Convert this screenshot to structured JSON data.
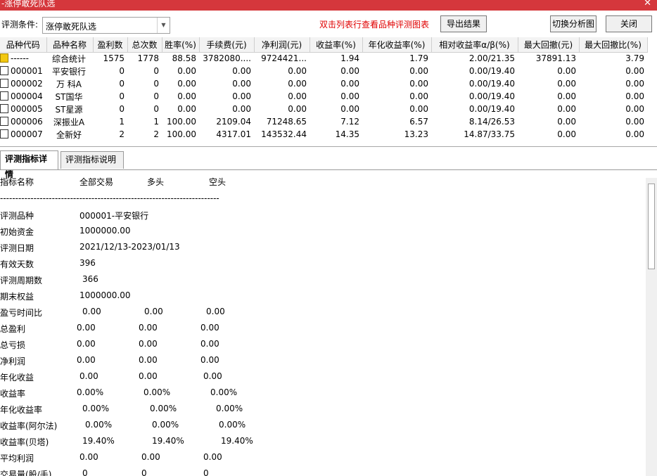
{
  "window": {
    "title": "-涨停敢死队选"
  },
  "toolbar": {
    "condition_label": "评测条件:",
    "condition_value": "涨停敢死队选",
    "hint": "双击列表行查看品种评测图表",
    "export_label": "导出结果",
    "switch_label": "切换分析图",
    "close_label": "关闭"
  },
  "grid": {
    "columns": [
      "品种代码",
      "品种名称",
      "盈利数",
      "总次数",
      "胜率(%)",
      "手续费(元)",
      "净利润(元)",
      "收益率(%)",
      "年化收益率(%)",
      "相对收益率α/β(%)",
      "最大回撤(元)",
      "最大回撤比(%)"
    ],
    "rows": [
      {
        "code": "------",
        "name": "综合统计",
        "win": "1575",
        "total": "1778",
        "rate": "88.58",
        "fee": "3782080....",
        "profit": "9724421...",
        "ret": "1.94",
        "annual": "1.79",
        "rel": "2.00/21.35",
        "dd": "37891.13",
        "ddr": "3.79",
        "summary": true
      },
      {
        "code": "000001",
        "name": "平安银行",
        "win": "0",
        "total": "0",
        "rate": "0.00",
        "fee": "0.00",
        "profit": "0.00",
        "ret": "0.00",
        "annual": "0.00",
        "rel": "0.00/19.40",
        "dd": "0.00",
        "ddr": "0.00"
      },
      {
        "code": "000002",
        "name": "万 科A",
        "win": "0",
        "total": "0",
        "rate": "0.00",
        "fee": "0.00",
        "profit": "0.00",
        "ret": "0.00",
        "annual": "0.00",
        "rel": "0.00/19.40",
        "dd": "0.00",
        "ddr": "0.00"
      },
      {
        "code": "000004",
        "name": "ST国华",
        "win": "0",
        "total": "0",
        "rate": "0.00",
        "fee": "0.00",
        "profit": "0.00",
        "ret": "0.00",
        "annual": "0.00",
        "rel": "0.00/19.40",
        "dd": "0.00",
        "ddr": "0.00"
      },
      {
        "code": "000005",
        "name": "ST星源",
        "win": "0",
        "total": "0",
        "rate": "0.00",
        "fee": "0.00",
        "profit": "0.00",
        "ret": "0.00",
        "annual": "0.00",
        "rel": "0.00/19.40",
        "dd": "0.00",
        "ddr": "0.00"
      },
      {
        "code": "000006",
        "name": "深振业A",
        "win": "1",
        "total": "1",
        "rate": "100.00",
        "fee": "2109.04",
        "profit": "71248.65",
        "ret": "7.12",
        "annual": "6.57",
        "rel": "8.14/26.53",
        "dd": "0.00",
        "ddr": "0.00"
      },
      {
        "code": "000007",
        "name": "全新好",
        "win": "2",
        "total": "2",
        "rate": "100.00",
        "fee": "4317.01",
        "profit": "143532.44",
        "ret": "14.35",
        "annual": "13.23",
        "rel": "14.87/33.75",
        "dd": "0.00",
        "ddr": "0.00"
      }
    ]
  },
  "tabs": [
    "评测指标详情",
    "评测指标说明"
  ],
  "detail": {
    "headers": [
      "指标名称",
      "全部交易",
      "多头",
      "空头"
    ],
    "dashes": "------------------------------------------------------------------------",
    "rows": [
      {
        "name": "评测品种",
        "all": "000001-平安银行",
        "long": "",
        "short": ""
      },
      {
        "name": "初始资金",
        "all": "1000000.00",
        "long": "",
        "short": ""
      },
      {
        "name": "评测日期",
        "all": "2021/12/13-2023/01/13",
        "long": "",
        "short": ""
      },
      {
        "name": "有效天数",
        "all": "396",
        "long": "",
        "short": ""
      },
      {
        "name": "评测周期数",
        "all": "366",
        "long": "",
        "short": ""
      },
      {
        "name": "期末权益",
        "all": "1000000.00",
        "long": "",
        "short": ""
      },
      {
        "name": "盈亏时间比",
        "all": "0.00",
        "long": "0.00",
        "short": "0.00"
      },
      {
        "name": "总盈利",
        "all": "0.00",
        "long": "0.00",
        "short": "0.00"
      },
      {
        "name": "总亏损",
        "all": "0.00",
        "long": "0.00",
        "short": "0.00"
      },
      {
        "name": "净利润",
        "all": "0.00",
        "long": "0.00",
        "short": "0.00"
      },
      {
        "name": "年化收益",
        "all": "0.00",
        "long": "0.00",
        "short": "0.00"
      },
      {
        "name": "收益率",
        "all": "0.00%",
        "long": "0.00%",
        "short": "0.00%"
      },
      {
        "name": "年化收益率",
        "all": "0.00%",
        "long": "0.00%",
        "short": "0.00%"
      },
      {
        "name": "收益率(阿尔法)",
        "all": "0.00%",
        "long": "0.00%",
        "short": "0.00%"
      },
      {
        "name": "收益率(贝塔)",
        "all": "19.40%",
        "long": "19.40%",
        "short": "19.40%"
      },
      {
        "name": "平均利润",
        "all": "0.00",
        "long": "0.00",
        "short": "0.00"
      },
      {
        "name": "交易量(股/手)",
        "all": "0",
        "long": "0",
        "short": "0"
      }
    ]
  }
}
